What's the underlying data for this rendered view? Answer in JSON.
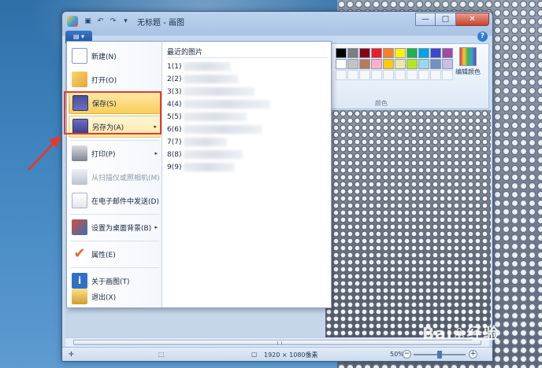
{
  "window": {
    "title": "无标题 - 画图",
    "controls": {
      "minimize": "—",
      "maximize": "□",
      "close": "✕"
    }
  },
  "quick_access": [
    "save-icon",
    "undo-icon",
    "redo-icon",
    "dropdown-icon"
  ],
  "ribbon": {
    "file_button_label": "▤ ▾",
    "help_label": "?",
    "colors_group_label": "颜色",
    "edit_colors_label": "编辑颜色",
    "palette": [
      "#000000",
      "#7f7f7f",
      "#880015",
      "#ed1c24",
      "#ff7f27",
      "#fff200",
      "#22b14c",
      "#00a2e8",
      "#3f48cc",
      "#a349a4",
      "#ffffff",
      "#c3c3c3",
      "#b97a57",
      "#ffaec9",
      "#ffc90e",
      "#efe4b0",
      "#b5e61d",
      "#99d9ea",
      "#7092be",
      "#c8bfe7"
    ]
  },
  "file_menu": {
    "items": [
      {
        "label": "新建(N)",
        "icon": "new-file-icon"
      },
      {
        "label": "打开(O)",
        "icon": "open-folder-icon"
      },
      {
        "label": "保存(S)",
        "icon": "save-disk-icon"
      },
      {
        "label": "另存为(A)",
        "icon": "save-as-icon",
        "arrow": "▸"
      },
      {
        "label": "打印(P)",
        "icon": "printer-icon",
        "arrow": "▸"
      },
      {
        "label": "从扫描仪或照相机(M)",
        "icon": "scanner-icon"
      },
      {
        "label": "在电子邮件中发送(D)",
        "icon": "email-icon"
      },
      {
        "label": "设置为桌面背景(B)",
        "icon": "desktop-background-icon",
        "arrow": "▸"
      },
      {
        "label": "属性(E)",
        "icon": "properties-check-icon"
      },
      {
        "label": "关于画图(T)",
        "icon": "about-info-icon"
      },
      {
        "label": "退出(X)",
        "icon": "exit-icon"
      }
    ],
    "recent_title": "最近的图片",
    "recent": [
      "1(1)",
      "2(2)",
      "3(3)",
      "4(4)",
      "5(5)",
      "6(6)",
      "7(7)",
      "8(8)",
      "9(9)"
    ]
  },
  "status": {
    "dimensions": "1920 × 1080像素",
    "zoom": "50%",
    "zoom_out": "−",
    "zoom_in": "+"
  },
  "watermark": "Bai❀经验"
}
